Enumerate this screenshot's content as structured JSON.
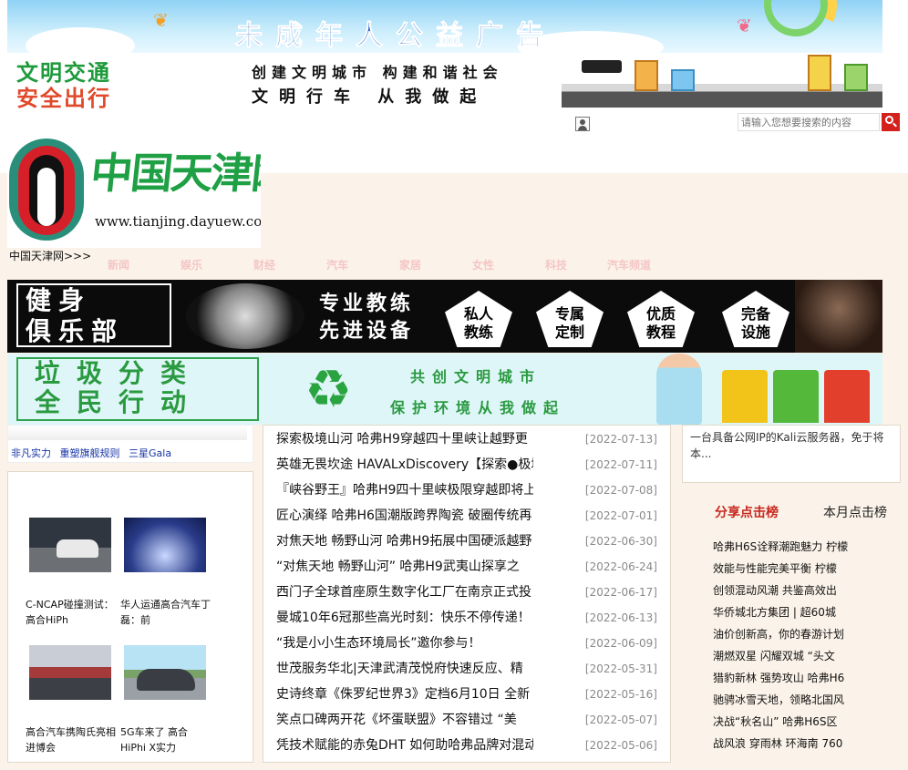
{
  "banners": {
    "public_title": "未成年人公益广告",
    "traffic_big_1": "文明交通",
    "traffic_big_2": "安全出行",
    "traffic_slogan_1": "创建文明城市 构建和谐社会",
    "traffic_slogan_2": "文明行车 从我做起",
    "gym_title": "健身\n俱乐部",
    "gym_pro": "专业教练\n先进设备",
    "gym_features": [
      "私人\n教练",
      "专属\n定制",
      "优质\n教程",
      "完备\n设施"
    ],
    "recycle_title": "垃圾分类\n全民行动",
    "recycle_slogan_1": "共创文明城市",
    "recycle_slogan_2": "保护环境从我做起"
  },
  "search": {
    "placeholder": "请输入您想要搜索的内容"
  },
  "logo": {
    "name": "中国天津网",
    "url": "www.tianjing.dayuew.com"
  },
  "breadcrumb": "中国天津网>>>",
  "nav": [
    "新闻",
    "娱乐",
    "财经",
    "汽车",
    "家居",
    "女性",
    "科技",
    "汽车频道"
  ],
  "left_links": [
    "非凡实力",
    "重塑旗舰规则",
    "三星Gala"
  ],
  "photos": [
    {
      "caption": "C-NCAP碰撞测试：高合HiPh",
      "icon": "car-crash-photo"
    },
    {
      "caption": "华人运通高合汽车丁磊：前",
      "icon": "conference-photo"
    },
    {
      "caption": "高合汽车携陶氏亮相进博会",
      "icon": "expo-photo"
    },
    {
      "caption": "5G车来了 高合HiPhi X实力",
      "icon": "car-photo"
    }
  ],
  "news": [
    {
      "title": "探索极境山河 哈弗H9穿越四十里峡让越野更",
      "date": "[2022-07-13]"
    },
    {
      "title": "英雄无畏坎途 HAVALxDiscovery【探索●极境",
      "date": "[2022-07-11]"
    },
    {
      "title": "『峡谷野王』哈弗H9四十里峡极限穿越即将上",
      "date": "[2022-07-08]"
    },
    {
      "title": "匠心演绎 哈弗H6国潮版跨界陶瓷 破圈传统再",
      "date": "[2022-07-01]"
    },
    {
      "title": "对焦天地 畅野山河 哈弗H9拓展中国硬派越野",
      "date": "[2022-06-30]"
    },
    {
      "title": "“对焦天地 畅野山河” 哈弗H9武夷山探享之",
      "date": "[2022-06-24]"
    },
    {
      "title": "西门子全球首座原生数字化工厂在南京正式投",
      "date": "[2022-06-17]"
    },
    {
      "title": "曼城10年6冠那些高光时刻：快乐不停传递！",
      "date": "[2022-06-13]"
    },
    {
      "title": "“我是小小生态环境局长”邀你参与！",
      "date": "[2022-06-09]"
    },
    {
      "title": "世茂服务华北|天津武清茂悦府快速反应、精",
      "date": "[2022-05-31]"
    },
    {
      "title": "史诗终章《侏罗纪世界3》定档6月10日 全新",
      "date": "[2022-05-16]"
    },
    {
      "title": "笑点口碑两开花《坏蛋联盟》不容错过 “美",
      "date": "[2022-05-07]"
    },
    {
      "title": "凭技术赋能的赤兔DHT 如何助哈弗品牌对混动",
      "date": "[2022-05-06]"
    }
  ],
  "right_box_text": "一台具备公网IP的Kali云服务器，免于将本...",
  "rank_tabs": {
    "share": "分享点击榜",
    "month": "本月点击榜"
  },
  "rank_list": [
    "哈弗H6S诠释潮跑魅力 柠檬",
    "效能与性能完美平衡 柠檬",
    "创领混动风潮 共鉴高效出",
    "华侨城北方集团 | 超60城",
    "油价创新高，你的春游计划",
    "潮燃双星 闪耀双城 “头文",
    "猎豹新林 强势攻山 哈弗H6",
    "驰骋冰雪天地，领略北国风",
    "决战“秋名山” 哈弗H6S区",
    "战风浪 穿雨林 环海南 760"
  ]
}
